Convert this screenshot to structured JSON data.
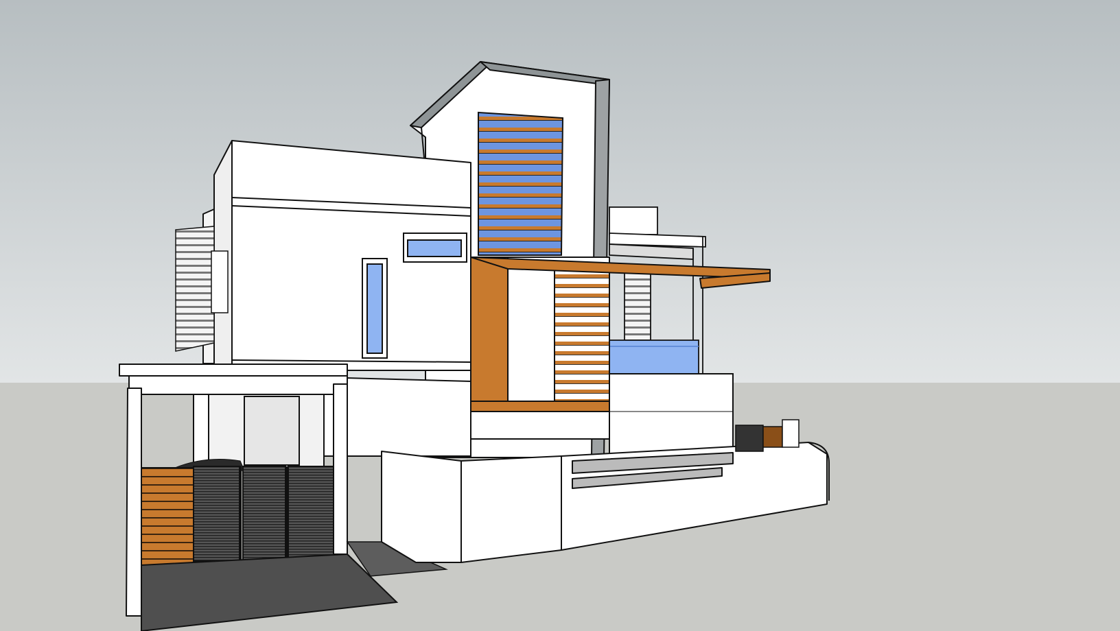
{
  "scene": {
    "type": "3d-model-viewport",
    "visible_text": [],
    "colors": {
      "sky_top": "#b9c0c3",
      "sky_bottom": "#dfe2e3",
      "ground": "#c9cac6",
      "wall": "#ffffff",
      "wall_shadow": "#e9e9e9",
      "outline": "#111111",
      "timber": "#c87a2e",
      "timber_dark": "#8a4f18",
      "glass": "#8fb4f2",
      "glass_dark": "#5d88d6",
      "gate_dark": "#3c3c3c",
      "driveway": "#4f4f4f",
      "concrete": "#9ea2a4"
    }
  }
}
